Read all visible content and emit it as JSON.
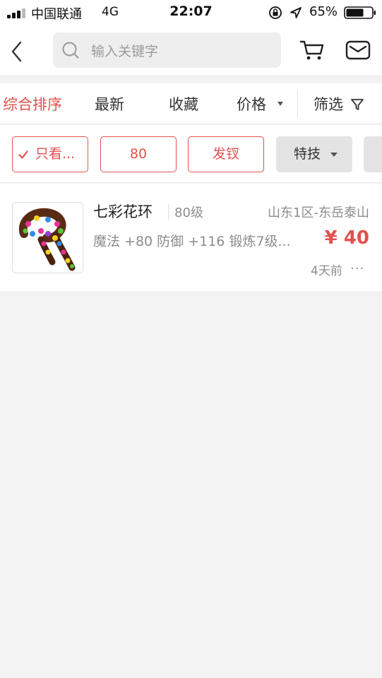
{
  "status_bar": {
    "carrier": "中国联通",
    "network": "4G",
    "time": "22:07",
    "battery": "65%",
    "icons": [
      "signal-icon",
      "lock-rotation-icon",
      "location-icon",
      "battery-icon"
    ]
  },
  "header": {
    "search_placeholder": "输入关键字",
    "icons": [
      "back-icon",
      "search-icon",
      "cart-icon",
      "mail-icon"
    ]
  },
  "sort_bar": {
    "items": [
      "综合排序",
      "最新",
      "收藏",
      "价格",
      "筛选"
    ],
    "active_index": 0
  },
  "chips": [
    {
      "label": "只看...",
      "style": "outline",
      "checked": true
    },
    {
      "label": "80",
      "style": "outline"
    },
    {
      "label": "发钗",
      "style": "outline"
    },
    {
      "label": "特技",
      "style": "filled",
      "has_dropdown": true
    }
  ],
  "listing": {
    "name": "七彩花环",
    "level": "80级",
    "server": "山东1区-东岳泰山",
    "stats": "魔法 +80 防御 +116 锻炼7级...",
    "price": "¥ 40",
    "time": "4天前",
    "more": "···"
  },
  "colors": {
    "accent": "#e2514f",
    "background": "#f3f3f3",
    "muted_text": "#8c8c8c"
  }
}
